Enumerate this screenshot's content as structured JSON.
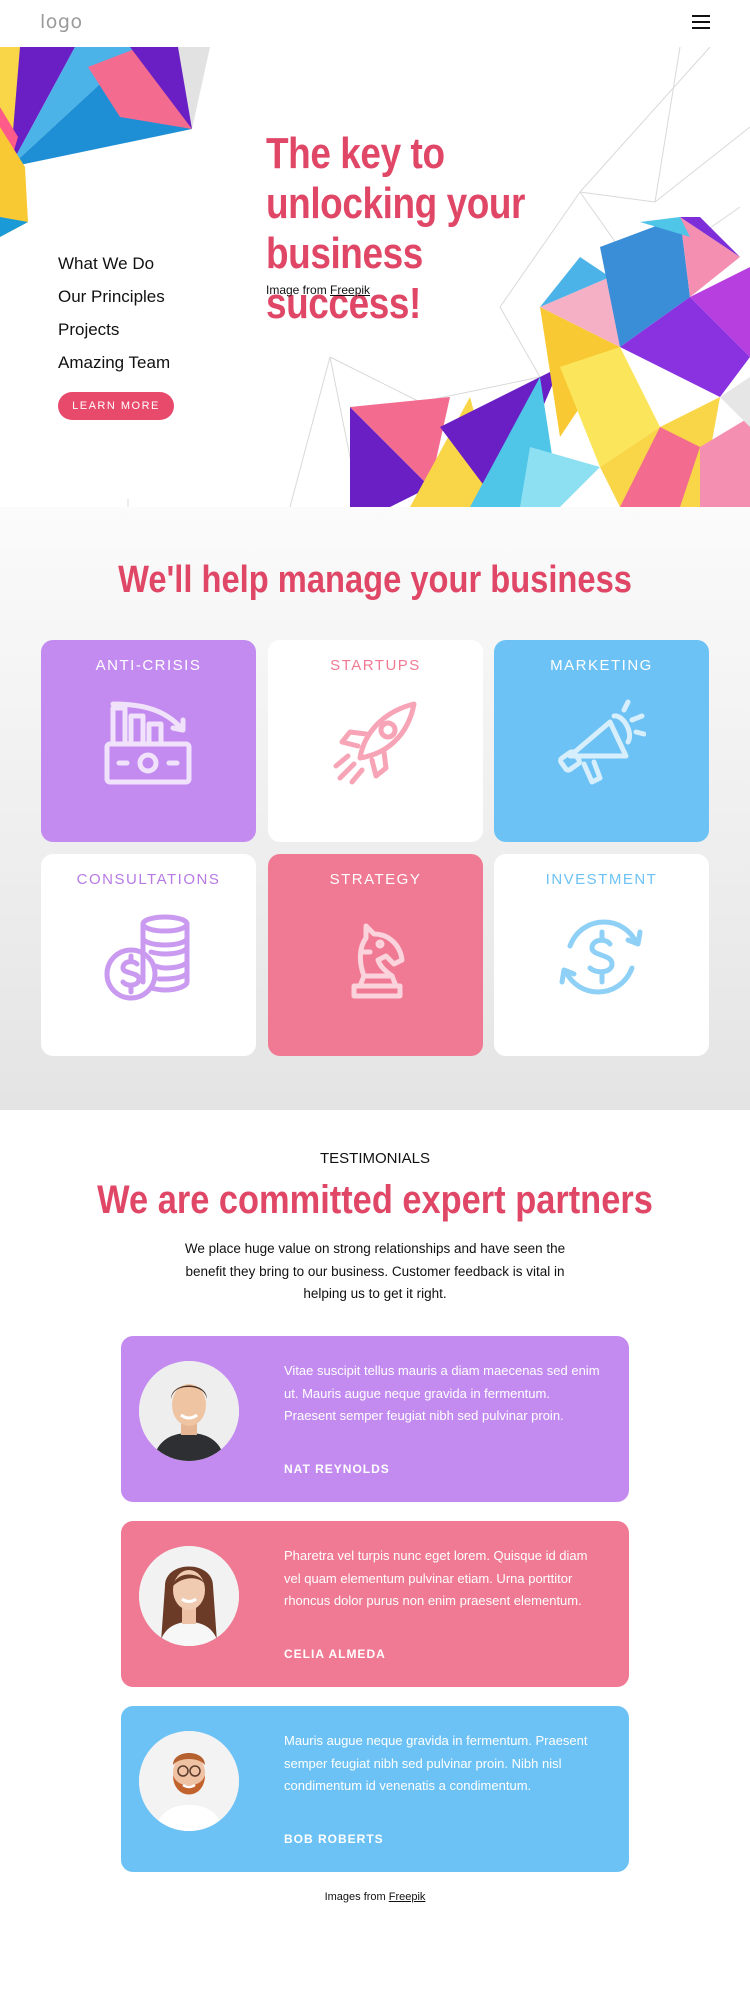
{
  "header": {
    "logo": "logo",
    "menu_icon": "hamburger-icon"
  },
  "hero": {
    "nav": [
      "What We Do",
      "Our Principles",
      "Projects",
      "Amazing Team"
    ],
    "button": "LEARN MORE",
    "title_lines": [
      "The key to",
      "unlocking your",
      "business success!"
    ],
    "credit_prefix": "Image from ",
    "credit_link": "Freepik"
  },
  "services": {
    "title": "We'll help manage your business",
    "cards": [
      {
        "label": "ANTI-CRISIS",
        "icon": "money-chart-icon",
        "bg": "#c38bf0",
        "fg": "#ffffff"
      },
      {
        "label": "STARTUPS",
        "icon": "rocket-icon",
        "bg": "#ffffff",
        "fg": "#f07a93"
      },
      {
        "label": "MARKETING",
        "icon": "megaphone-icon",
        "bg": "#6cc2f5",
        "fg": "#ffffff"
      },
      {
        "label": "CONSULTATIONS",
        "icon": "coins-icon",
        "bg": "#ffffff",
        "fg": "#b77ae4"
      },
      {
        "label": "STRATEGY",
        "icon": "chess-knight-icon",
        "bg": "#f07a93",
        "fg": "#ffffff"
      },
      {
        "label": "INVESTMENT",
        "icon": "dollar-cycle-icon",
        "bg": "#ffffff",
        "fg": "#6cc2f5"
      }
    ]
  },
  "testimonials": {
    "subtitle": "TESTIMONIALS",
    "title": "We are committed expert partners",
    "intro": "We place huge value on strong relationships and have seen the benefit they bring to our business. Customer feedback is vital in helping us to get it right.",
    "items": [
      {
        "quote": "Vitae suscipit tellus mauris a diam maecenas sed enim ut. Mauris augue neque gravida in fermentum. Praesent semper feugiat nibh sed pulvinar proin.",
        "name": "NAT REYNOLDS",
        "bg": "#c38bf0"
      },
      {
        "quote": "Pharetra vel turpis nunc eget lorem. Quisque id diam vel quam elementum pulvinar etiam. Urna porttitor rhoncus dolor purus non enim praesent elementum.",
        "name": "CELIA ALMEDA",
        "bg": "#f07a93"
      },
      {
        "quote": "Mauris augue neque gravida in fermentum. Praesent semper feugiat nibh sed pulvinar proin. Nibh nisl condimentum id venenatis a condimentum.",
        "name": "BOB ROBERTS",
        "bg": "#6cc2f5"
      }
    ],
    "credit_prefix": "Images from ",
    "credit_link": "Freepik"
  },
  "colors": {
    "accent": "#e04766",
    "button": "#e84a6c"
  }
}
